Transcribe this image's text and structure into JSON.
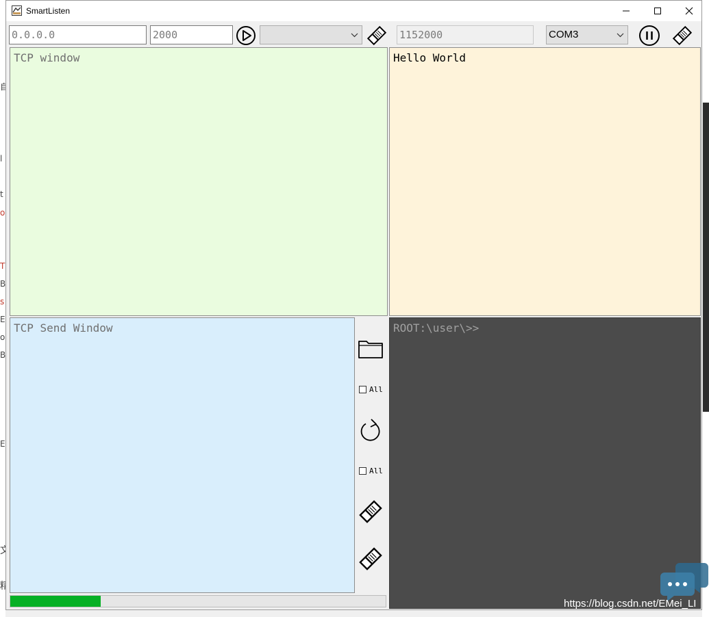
{
  "window": {
    "title": "SmartListen"
  },
  "toolbar": {
    "ip_value": "0.0.0.0",
    "port_value": "2000",
    "net_select_value": "",
    "baud_value": "1152000",
    "com_port_value": "COM3"
  },
  "panels": {
    "tcp_receive": "TCP window",
    "serial_receive": "Hello World",
    "tcp_send": "TCP Send Window",
    "terminal_prompt": "ROOT:\\user\\>>"
  },
  "side_controls": {
    "checkbox1_label": "All",
    "checkbox2_label": "All"
  },
  "progress": {
    "value": 0.24,
    "color": "#06b025"
  },
  "watermark": {
    "text": "https://blog.csdn.net/EMei_LI"
  },
  "background_chars": [
    "自",
    "l",
    "t",
    "o",
    "T",
    "B",
    "s",
    "E",
    "o",
    "B",
    "E",
    "文",
    "精"
  ],
  "colors": {
    "tcp_receive_bg": "#eafcdf",
    "serial_receive_bg": "#fef3da",
    "tcp_send_bg": "#d9eefc",
    "terminal_bg": "#4b4b4b"
  },
  "icons": [
    "app-icon",
    "minimize-icon",
    "maximize-icon",
    "close-icon",
    "play-icon",
    "eraser-icon",
    "pause-icon",
    "folder-icon",
    "refresh-icon",
    "chevron-down-icon",
    "chat-icon"
  ]
}
